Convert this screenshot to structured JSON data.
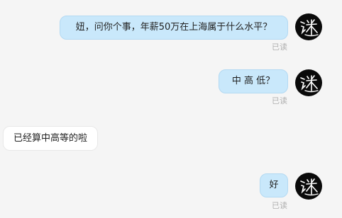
{
  "messages": [
    {
      "direction": "outgoing",
      "text": "妞，问你个事，年薪50万在上海属于什么水平？",
      "status": "已读"
    },
    {
      "direction": "outgoing",
      "text": "中 高 低？",
      "status": "已读"
    },
    {
      "direction": "incoming",
      "text": "已经算中高等的啦"
    },
    {
      "direction": "outgoing",
      "text": "好",
      "status": "已读"
    }
  ],
  "avatar": {
    "icon": "calligraphy-mi-icon",
    "colors": {
      "background": "#0a0a0a",
      "glyph": "#ffffff"
    }
  },
  "colors": {
    "background": "#f5f5f5",
    "outgoing_bubble": "#c9e8fb",
    "incoming_bubble": "#ffffff",
    "read_text": "#b0b0b0"
  }
}
